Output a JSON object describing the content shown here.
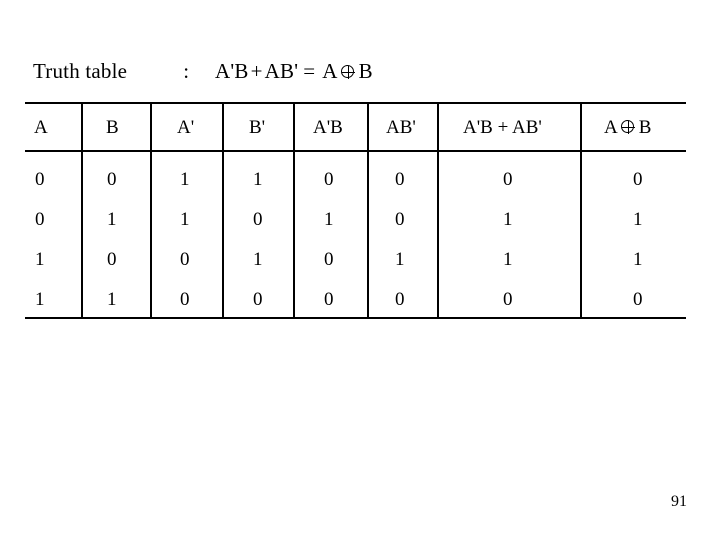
{
  "slide": {
    "title": {
      "label": "Truth table",
      "separator": ":",
      "expr_left_a": "A'B",
      "expr_plus": "+",
      "expr_left_b": "AB'",
      "expr_equals": "=",
      "expr_right_a": "A",
      "expr_xor_icon": "circled-plus-icon",
      "expr_right_b": "B"
    },
    "page_number": "91"
  },
  "chart_data": {
    "type": "table",
    "title": "Truth table : A'B + AB' = A ⊕ B",
    "columns": [
      "A",
      "B",
      "A'",
      "B'",
      "A'B",
      "AB'",
      "A'B + AB'",
      "A ⊕ B"
    ],
    "rows": [
      [
        "0",
        "0",
        "1",
        "1",
        "0",
        "0",
        "0",
        "0"
      ],
      [
        "0",
        "1",
        "1",
        "0",
        "1",
        "0",
        "1",
        "1"
      ],
      [
        "1",
        "0",
        "0",
        "1",
        "0",
        "1",
        "1",
        "1"
      ],
      [
        "1",
        "1",
        "0",
        "0",
        "0",
        "0",
        "0",
        "0"
      ]
    ]
  },
  "colors": {
    "background": "#ffffff",
    "ink": "#000000"
  }
}
